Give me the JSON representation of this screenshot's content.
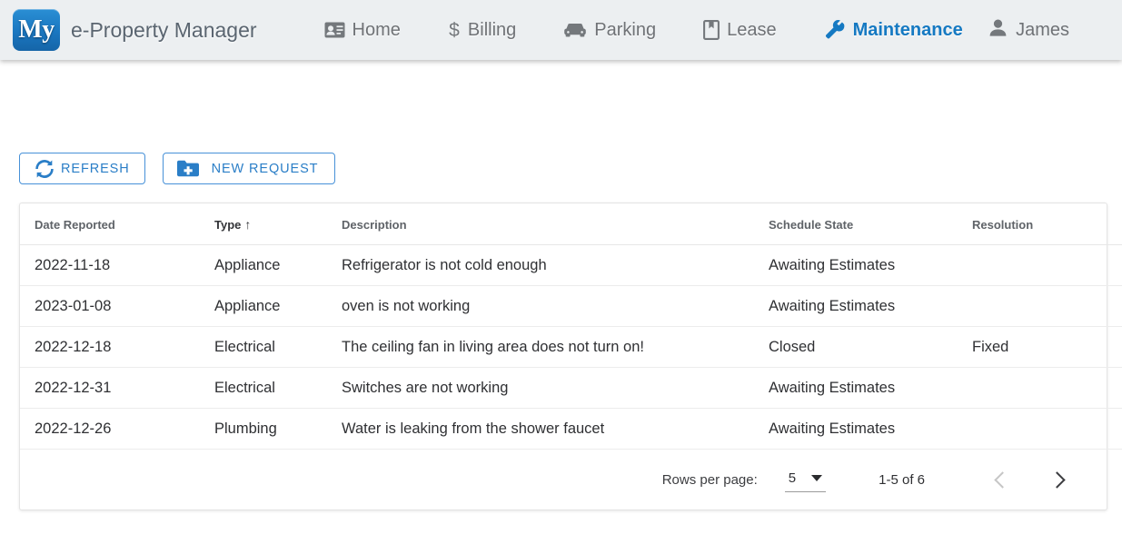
{
  "brand": {
    "logo_text": "My",
    "title": "e-Property Manager"
  },
  "nav": {
    "items": [
      {
        "label": "Home",
        "icon": "contact-card-icon",
        "active": false
      },
      {
        "label": "Billing",
        "icon": "dollar-icon",
        "active": false
      },
      {
        "label": "Parking",
        "icon": "car-icon",
        "active": false
      },
      {
        "label": "Lease",
        "icon": "book-bookmark-icon",
        "active": false
      },
      {
        "label": "Maintenance",
        "icon": "wrench-icon",
        "active": true
      }
    ],
    "user": {
      "label": "James",
      "icon": "person-icon"
    }
  },
  "toolbar_actions": {
    "refresh_label": "REFRESH",
    "new_request_label": "NEW REQUEST"
  },
  "table": {
    "columns": [
      {
        "label": "Date Reported",
        "sorted": false
      },
      {
        "label": "Type",
        "sorted": true,
        "sort_arrow": "↑"
      },
      {
        "label": "Description",
        "sorted": false
      },
      {
        "label": "Schedule State",
        "sorted": false
      },
      {
        "label": "Resolution",
        "sorted": false
      }
    ],
    "rows": [
      {
        "date": "2022-11-18",
        "type": "Appliance",
        "description": "Refrigerator is not cold enough",
        "state": "Awaiting Estimates",
        "resolution": ""
      },
      {
        "date": "2023-01-08",
        "type": "Appliance",
        "description": "oven is not working",
        "state": "Awaiting Estimates",
        "resolution": ""
      },
      {
        "date": "2022-12-18",
        "type": "Electrical",
        "description": "The ceiling fan in living area does not turn on!",
        "state": "Closed",
        "resolution": "Fixed"
      },
      {
        "date": "2022-12-31",
        "type": "Electrical",
        "description": "Switches are not working",
        "state": "Awaiting Estimates",
        "resolution": ""
      },
      {
        "date": "2022-12-26",
        "type": "Plumbing",
        "description": "Water is leaking from the shower faucet",
        "state": "Awaiting Estimates",
        "resolution": ""
      }
    ]
  },
  "paginator": {
    "rows_per_page_label": "Rows per page:",
    "rows_per_page_value": "5",
    "range_label": "1-5 of 6",
    "prev_enabled": false,
    "next_enabled": true
  },
  "colors": {
    "accent": "#1579c2",
    "button_border": "#4791d8",
    "toolbar_bg": "#eceff1",
    "nav_text": "#6f7276"
  }
}
